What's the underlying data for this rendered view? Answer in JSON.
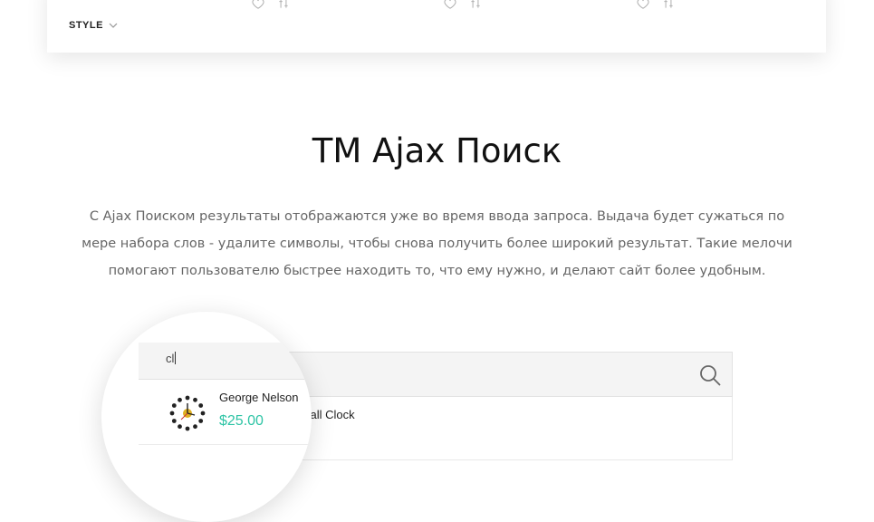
{
  "filter": {
    "style_label": "STYLE",
    "chevron_icon": "chevron-down-icon"
  },
  "product_actions": {
    "icons": [
      "heart-icon",
      "compare-icon"
    ]
  },
  "section": {
    "title": "TM Ajax Поиск",
    "description": "С Ajax Поиском результаты отображаются уже во время ввода запроса. Выдача будет сужаться по мере набора слов - удалите символы, чтобы снова получить более широкий результат. Такие мелочи помогают пользователю быстрее находить то, что ему нужно, и делают сайт более удобным."
  },
  "search": {
    "query": "cl",
    "button_icon": "search-icon"
  },
  "results": [
    {
      "title_visible_in_magnifier": "George Nelson",
      "title_visible_in_panel": "n Ball Clock",
      "price": "$25.00",
      "thumbnail_icon": "ball-clock-icon"
    }
  ],
  "colors": {
    "price": "#2ec4a5",
    "title": "#111111",
    "text": "#666666"
  }
}
